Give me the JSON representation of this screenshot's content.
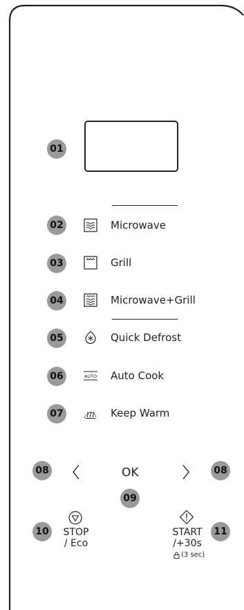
{
  "callouts": [
    "01",
    "02",
    "03",
    "04",
    "05",
    "06",
    "07",
    "08",
    "09",
    "10",
    "11"
  ],
  "modes": [
    {
      "label": "Microwave",
      "icon": "microwave-icon"
    },
    {
      "label": "Grill",
      "icon": "grill-icon"
    },
    {
      "label": "Microwave+Grill",
      "icon": "microwave-grill-icon"
    },
    {
      "label": "Quick Defrost",
      "icon": "quick-defrost-icon"
    },
    {
      "label": "Auto Cook",
      "icon": "auto-cook-icon",
      "icon_text": "AUTO"
    },
    {
      "label": "Keep Warm",
      "icon": "keep-warm-icon"
    }
  ],
  "nav": {
    "ok_label": "OK",
    "left_icon": "chevron-left-icon",
    "right_icon": "chevron-right-icon"
  },
  "stop": {
    "line1": "STOP",
    "line2": "/ Eco",
    "icon": "stop-eco-icon"
  },
  "start": {
    "line1": "START",
    "line2": "/+30s",
    "lock_note": "(3 sec)",
    "icon": "start-icon",
    "lock_icon": "lock-icon"
  }
}
